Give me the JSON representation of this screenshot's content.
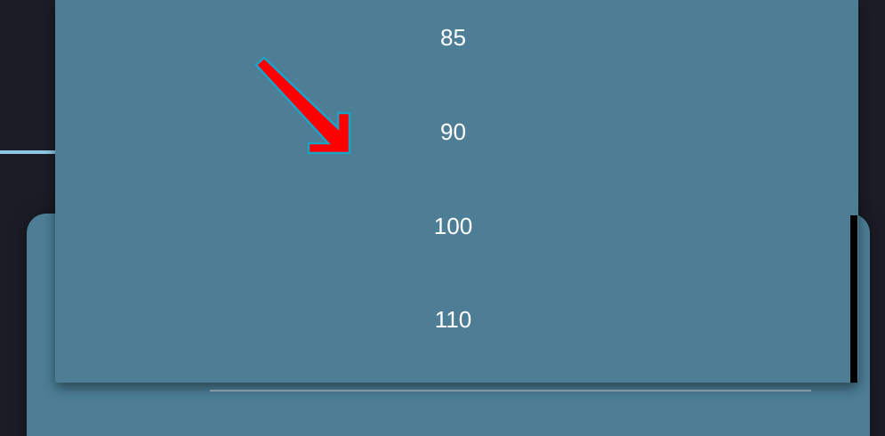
{
  "dropdown": {
    "options": [
      {
        "label": "85"
      },
      {
        "label": "90"
      },
      {
        "label": "100"
      },
      {
        "label": "110"
      }
    ]
  },
  "colors": {
    "background": "#1b1c26",
    "surface": "#4d7e96",
    "accent_line": "#8fc9e6",
    "text": "#ffffff",
    "annotation_arrow": "#ff0000"
  },
  "icons": {
    "annotation": "red-arrow-pointing-down-right"
  }
}
